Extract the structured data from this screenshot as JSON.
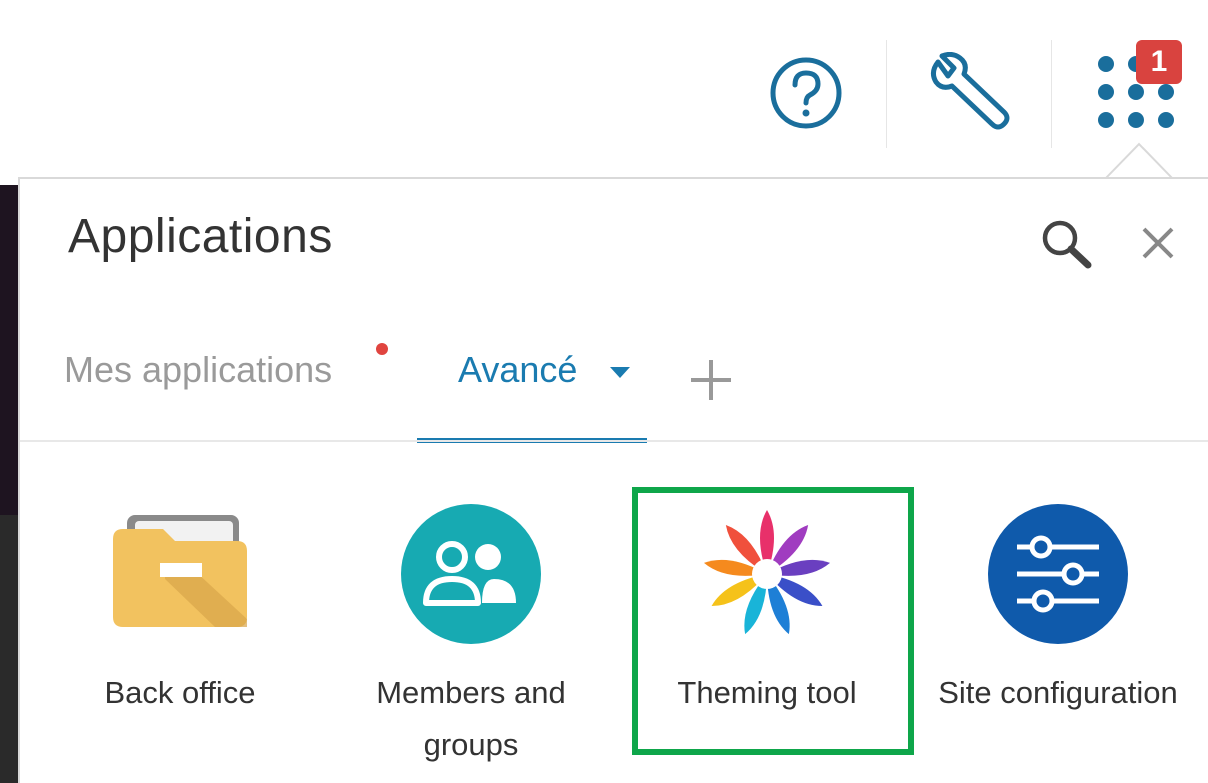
{
  "toolbar": {
    "notification_count": "1",
    "icons": [
      "help-circle-icon",
      "wrench-icon",
      "apps-grid-icon"
    ]
  },
  "panel": {
    "title": "Applications",
    "icons": [
      "search-icon",
      "close-icon"
    ]
  },
  "tabs": [
    {
      "label": "Mes applications",
      "active": false,
      "has_dot": true
    },
    {
      "label": "Avancé",
      "active": true,
      "has_dropdown": true
    }
  ],
  "apps": [
    {
      "label": "Back office",
      "icon": "folder-icon"
    },
    {
      "label": "Members and groups",
      "icon": "users-icon"
    },
    {
      "label": "Theming tool",
      "icon": "flower-icon",
      "highlighted": true
    },
    {
      "label": "Site configuration",
      "icon": "sliders-icon"
    }
  ],
  "colors": {
    "accent": "#1a7bb0",
    "badge": "#d9433f",
    "highlight": "#0ea64a",
    "members_bg": "#17aab2",
    "site_bg": "#0f5aab",
    "folder": "#f0c060"
  }
}
